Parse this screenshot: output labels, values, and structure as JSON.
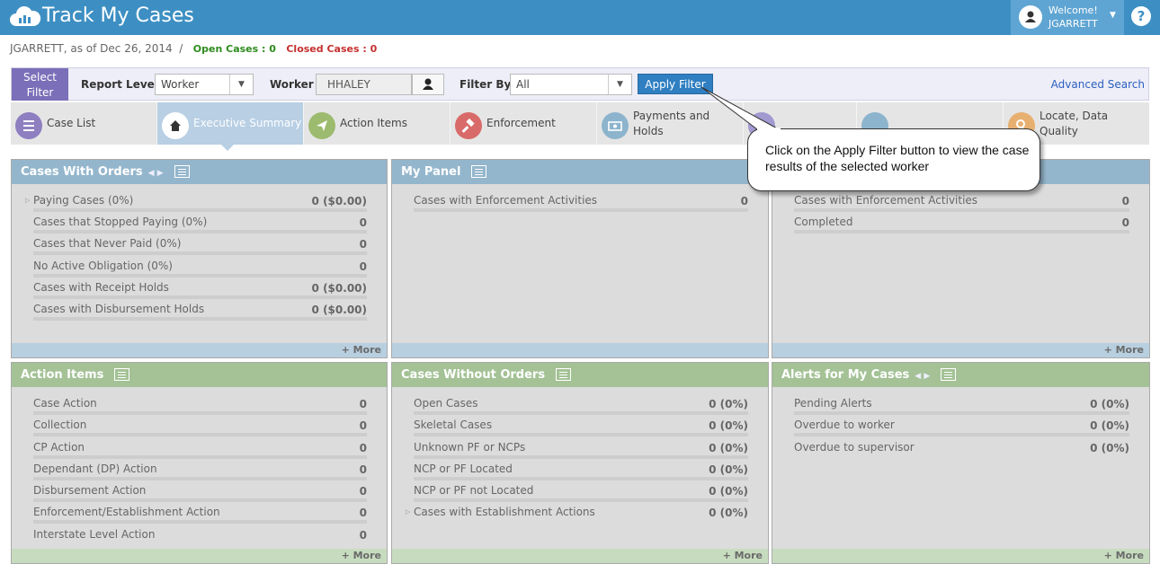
{
  "header": {
    "app_title": "Track My Cases",
    "welcome_label": "Welcome!",
    "username": "JGARRETT",
    "help_symbol": "?",
    "colors": {
      "bar": "#3d8fc3",
      "user_box": "#5fa5d3"
    }
  },
  "status": {
    "user_date": "JGARRETT, as of Dec 26, 2014",
    "separator": "/",
    "open_cases": "Open Cases : 0",
    "closed_cases": "Closed Cases : 0"
  },
  "filter": {
    "select_filter_line1": "Select",
    "select_filter_line2": "Filter",
    "report_level_label": "Report Level",
    "report_level_value": "Worker",
    "worker_label": "Worker",
    "worker_value": "HHALEY",
    "filter_by_label": "Filter By",
    "filter_by_value": "All",
    "apply_button": "Apply Filter",
    "advanced_search": "Advanced Search"
  },
  "tabs": [
    {
      "label": "Case List",
      "icon": "list-icon",
      "color": "#8e7fc1"
    },
    {
      "label": "Executive Summary",
      "icon": "home-icon",
      "color": "#ffffff",
      "active": true
    },
    {
      "label": "Action Items",
      "icon": "send-icon",
      "color": "#9dbb6e"
    },
    {
      "label": "Enforcement",
      "icon": "gavel-icon",
      "color": "#d96a6a"
    },
    {
      "label": "Payments and Holds",
      "icon": "money-icon",
      "color": "#8db4cd"
    },
    {
      "label": "",
      "icon": "alert-icon",
      "color": "#a19ad0"
    },
    {
      "label": "",
      "icon": "gear-icon",
      "color": "#8db4cd"
    },
    {
      "label": "Locate, Data Quality",
      "icon": "search-icon",
      "color": "#e8b070"
    }
  ],
  "panels": {
    "cases_with_orders": {
      "title": "Cases With Orders",
      "more": "+ More",
      "rows": [
        {
          "label": "Paying Cases (0%)",
          "value": "0 ($0.00)"
        },
        {
          "label": "Cases that Stopped Paying (0%)",
          "value": "0"
        },
        {
          "label": "Cases that Never Paid (0%)",
          "value": "0"
        },
        {
          "label": "No Active Obligation (0%)",
          "value": "0"
        },
        {
          "label": "Cases with Receipt Holds",
          "value": "0 ($0.00)"
        },
        {
          "label": "Cases with Disbursement Holds",
          "value": "0 ($0.00)"
        }
      ]
    },
    "my_panel": {
      "title": "My Panel",
      "rows": [
        {
          "label": "Cases with Enforcement Activities",
          "value": "0"
        }
      ]
    },
    "right_top": {
      "more": "+ More",
      "rows": [
        {
          "label": "Cases with Enforcement Activities",
          "value": "0"
        },
        {
          "label": "Completed",
          "value": "0"
        }
      ]
    },
    "action_items": {
      "title": "Action Items",
      "more": "+ More",
      "rows": [
        {
          "label": "Case Action",
          "value": "0"
        },
        {
          "label": "Collection",
          "value": "0"
        },
        {
          "label": "CP Action",
          "value": "0"
        },
        {
          "label": "Dependant (DP) Action",
          "value": "0"
        },
        {
          "label": "Disbursement Action",
          "value": "0"
        },
        {
          "label": "Enforcement/Establishment Action",
          "value": "0"
        },
        {
          "label": "Interstate Level Action",
          "value": "0"
        }
      ]
    },
    "cases_without_orders": {
      "title": "Cases Without Orders",
      "more": "+ More",
      "rows": [
        {
          "label": "Open Cases",
          "value": "0 (0%)"
        },
        {
          "label": "Skeletal Cases",
          "value": "0 (0%)"
        },
        {
          "label": "Unknown PF or NCPs",
          "value": "0 (0%)"
        },
        {
          "label": "NCP or PF Located",
          "value": "0 (0%)"
        },
        {
          "label": "NCP or PF not Located",
          "value": "0 (0%)"
        },
        {
          "label": "Cases with Establishment Actions",
          "value": "0 (0%)"
        }
      ]
    },
    "alerts": {
      "title": "Alerts for My Cases",
      "more": "+ More",
      "rows": [
        {
          "label": "Pending Alerts",
          "value": "0 (0%)"
        },
        {
          "label": "Overdue to worker",
          "value": "0 (0%)"
        },
        {
          "label": "Overdue to supervisor",
          "value": "0 (0%)"
        }
      ]
    }
  },
  "callout": {
    "text": "Click on the Apply Filter button to view the case results of the selected worker"
  }
}
